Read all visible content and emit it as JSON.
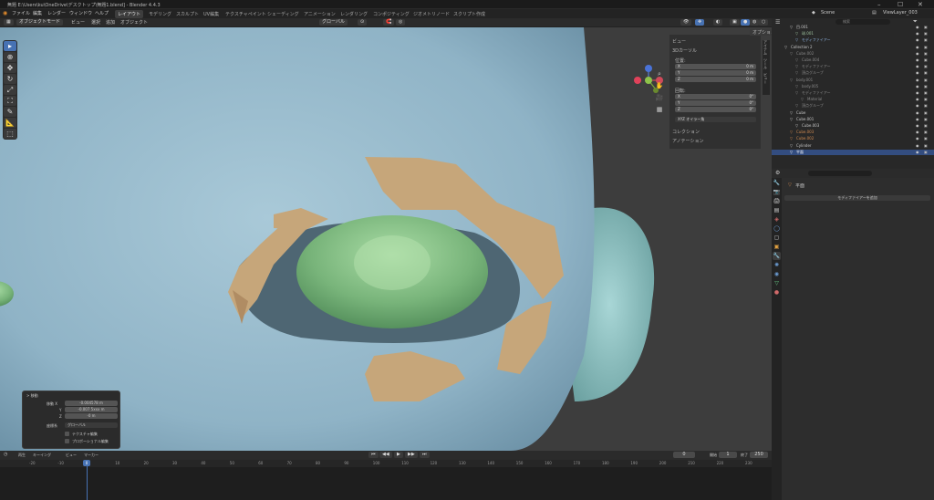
{
  "titlebar": {
    "title": "無題 E:\\Users\\ku\\OneDrive\\デスクトップ\\無題1.blend] - Blender 4.4.3",
    "min": "–",
    "max": "☐",
    "close": "✕"
  },
  "menu": [
    "ファイル",
    "編集",
    "レンダー",
    "ウィンドウ",
    "ヘルプ"
  ],
  "workspaces": [
    "レイアウト",
    "モデリング",
    "スカルプト",
    "UV編集",
    "テクスチャペイント",
    "シェーディング",
    "アニメーション",
    "レンダリング",
    "コンポジティング",
    "ジオメトリノード",
    "スクリプト作成"
  ],
  "scene": {
    "name": "Scene",
    "viewlayer": "ViewLayer_003"
  },
  "viewport_header": {
    "mode": "オブジェクトモード",
    "menus": [
      "ビュー",
      "選択",
      "追加",
      "オブジェクト"
    ],
    "orientation": "グローバル",
    "options": "オプション"
  },
  "npanel": {
    "section_view": "ビュー",
    "section_cursor": "3Dカーソル",
    "location": "位置:",
    "loc_fields": [
      {
        "axis": "X",
        "value": "0 m"
      },
      {
        "axis": "Y",
        "value": "0 m"
      },
      {
        "axis": "Z",
        "value": "0 m"
      }
    ],
    "rotation": "回転:",
    "rot_fields": [
      {
        "axis": "X",
        "value": "0°"
      },
      {
        "axis": "Y",
        "value": "0°"
      },
      {
        "axis": "Z",
        "value": "0°"
      }
    ],
    "rot_mode": "XYZ オイラー角",
    "collection": "コレクション",
    "annotation": "アノテーション"
  },
  "side_tabs": [
    "アイテム",
    "ツール",
    "ビュー"
  ],
  "operator_panel": {
    "title": "> 移動",
    "rows": [
      {
        "label": "移動 X",
        "value": "-0.004578 m"
      },
      {
        "label": "Y",
        "value": "-0.007 5xxx m"
      },
      {
        "label": "Z",
        "value": "-0 m"
      }
    ],
    "orient_label": "座標系",
    "orient_value": "グローバル",
    "check1": "テクスチャ編集",
    "check2": "プロポーショナル編集"
  },
  "timeline": {
    "menus": [
      "再生",
      "キーイング",
      "ビュー",
      "マーカー"
    ],
    "frame": "0",
    "start_label": "開始",
    "start": "1",
    "end_label": "終了",
    "end": "250",
    "ticks": [
      "-20",
      "-10",
      "0",
      "10",
      "20",
      "30",
      "40",
      "50",
      "60",
      "70",
      "80",
      "90",
      "100",
      "110",
      "120",
      "130",
      "140",
      "150",
      "160",
      "170",
      "180",
      "190",
      "200",
      "210",
      "220",
      "230"
    ]
  },
  "outliner": {
    "search": "検索",
    "rows": [
      {
        "name": "目.001",
        "indent": 1,
        "color": "#c8c8c8"
      },
      {
        "name": "球.001",
        "indent": 2,
        "color": "#9fc49f"
      },
      {
        "name": "モディファイアー",
        "indent": 2,
        "color": "#8fb4e0"
      },
      {
        "name": "Collection 2",
        "indent": 0,
        "color": "#c8c8c8"
      },
      {
        "name": "Cube.002",
        "indent": 1,
        "color": "#888"
      },
      {
        "name": "Cube.004",
        "indent": 2,
        "color": "#888"
      },
      {
        "name": "モディファイアー",
        "indent": 2,
        "color": "#888"
      },
      {
        "name": "頂点グループ",
        "indent": 2,
        "color": "#888"
      },
      {
        "name": "body.001",
        "indent": 1,
        "color": "#888"
      },
      {
        "name": "body.005",
        "indent": 2,
        "color": "#888"
      },
      {
        "name": "モディファイアー",
        "indent": 2,
        "color": "#888"
      },
      {
        "name": "Material",
        "indent": 3,
        "color": "#888"
      },
      {
        "name": "頂点グループ",
        "indent": 2,
        "color": "#888"
      },
      {
        "name": "Cube",
        "indent": 1,
        "color": "#c8c8c8"
      },
      {
        "name": "Cube.001",
        "indent": 1,
        "color": "#c8c8c8"
      },
      {
        "name": "Cube.003",
        "indent": 2,
        "color": "#c8c8c8"
      },
      {
        "name": "Cube.003",
        "indent": 1,
        "color": "#d08a50"
      },
      {
        "name": "Cube.002",
        "indent": 1,
        "color": "#d08a50"
      },
      {
        "name": "Cylinder",
        "indent": 1,
        "color": "#c8c8c8"
      },
      {
        "name": "平面",
        "indent": 1,
        "color": "#ffffff",
        "selected": true
      }
    ]
  },
  "properties": {
    "object": "平面",
    "add_modifier": "モディファイアーを追加"
  }
}
